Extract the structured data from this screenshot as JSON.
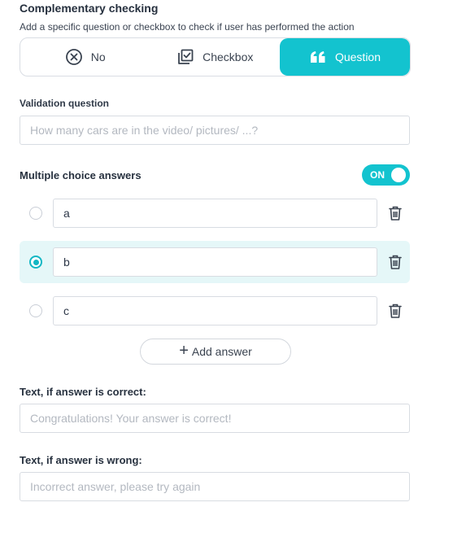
{
  "header": {
    "title": "Complementary checking",
    "subtitle": "Add a specific question or checkbox to check if user has performed the action"
  },
  "mode_selector": {
    "options": [
      {
        "label": "No",
        "icon": "circle-x-icon"
      },
      {
        "label": "Checkbox",
        "icon": "checkbox-stack-icon"
      },
      {
        "label": "Question",
        "icon": "quote-icon"
      }
    ],
    "selected": "Question",
    "accent_color": "#13c3cf"
  },
  "validation": {
    "label": "Validation question",
    "placeholder": "How many cars are in the video/ pictures/ ...?",
    "value": ""
  },
  "multiple_choice": {
    "label": "Multiple choice answers",
    "toggle_label": "ON",
    "enabled": true,
    "answers": [
      {
        "value": "a",
        "correct": false
      },
      {
        "value": "b",
        "correct": true
      },
      {
        "value": "c",
        "correct": false
      }
    ],
    "add_label": "Add answer"
  },
  "correct_text": {
    "label": "Text, if answer is correct:",
    "placeholder": "Congratulations! Your answer is correct!",
    "value": ""
  },
  "wrong_text": {
    "label": "Text, if answer is wrong:",
    "placeholder": "Incorrect answer, please try again",
    "value": ""
  }
}
